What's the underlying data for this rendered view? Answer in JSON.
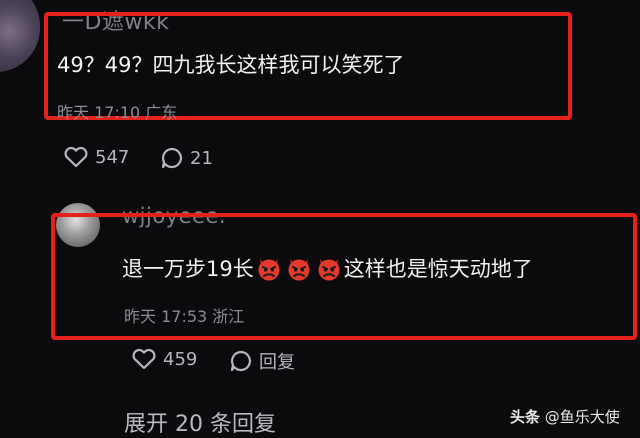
{
  "comments": [
    {
      "username": "一D遮wkk",
      "text": "49？49？四九我长这样我可以笑死了",
      "time": "昨天 17:10",
      "location": "广东",
      "likes": "547",
      "replies": "21"
    },
    {
      "username": "wjjoyeee.",
      "text_before": "退一万步19长",
      "text_after": "这样也是惊天动地了",
      "emoji_name": "angry-devil-emoji",
      "time": "昨天 17:53",
      "location": "浙江",
      "likes": "459",
      "reply_label": "回复"
    }
  ],
  "expand_replies_label": "展开 20 条回复",
  "watermark": {
    "platform": "头条",
    "author": "@鱼乐大使"
  },
  "colors": {
    "background": "#0b0b0d",
    "highlight_box": "#e6211c"
  }
}
